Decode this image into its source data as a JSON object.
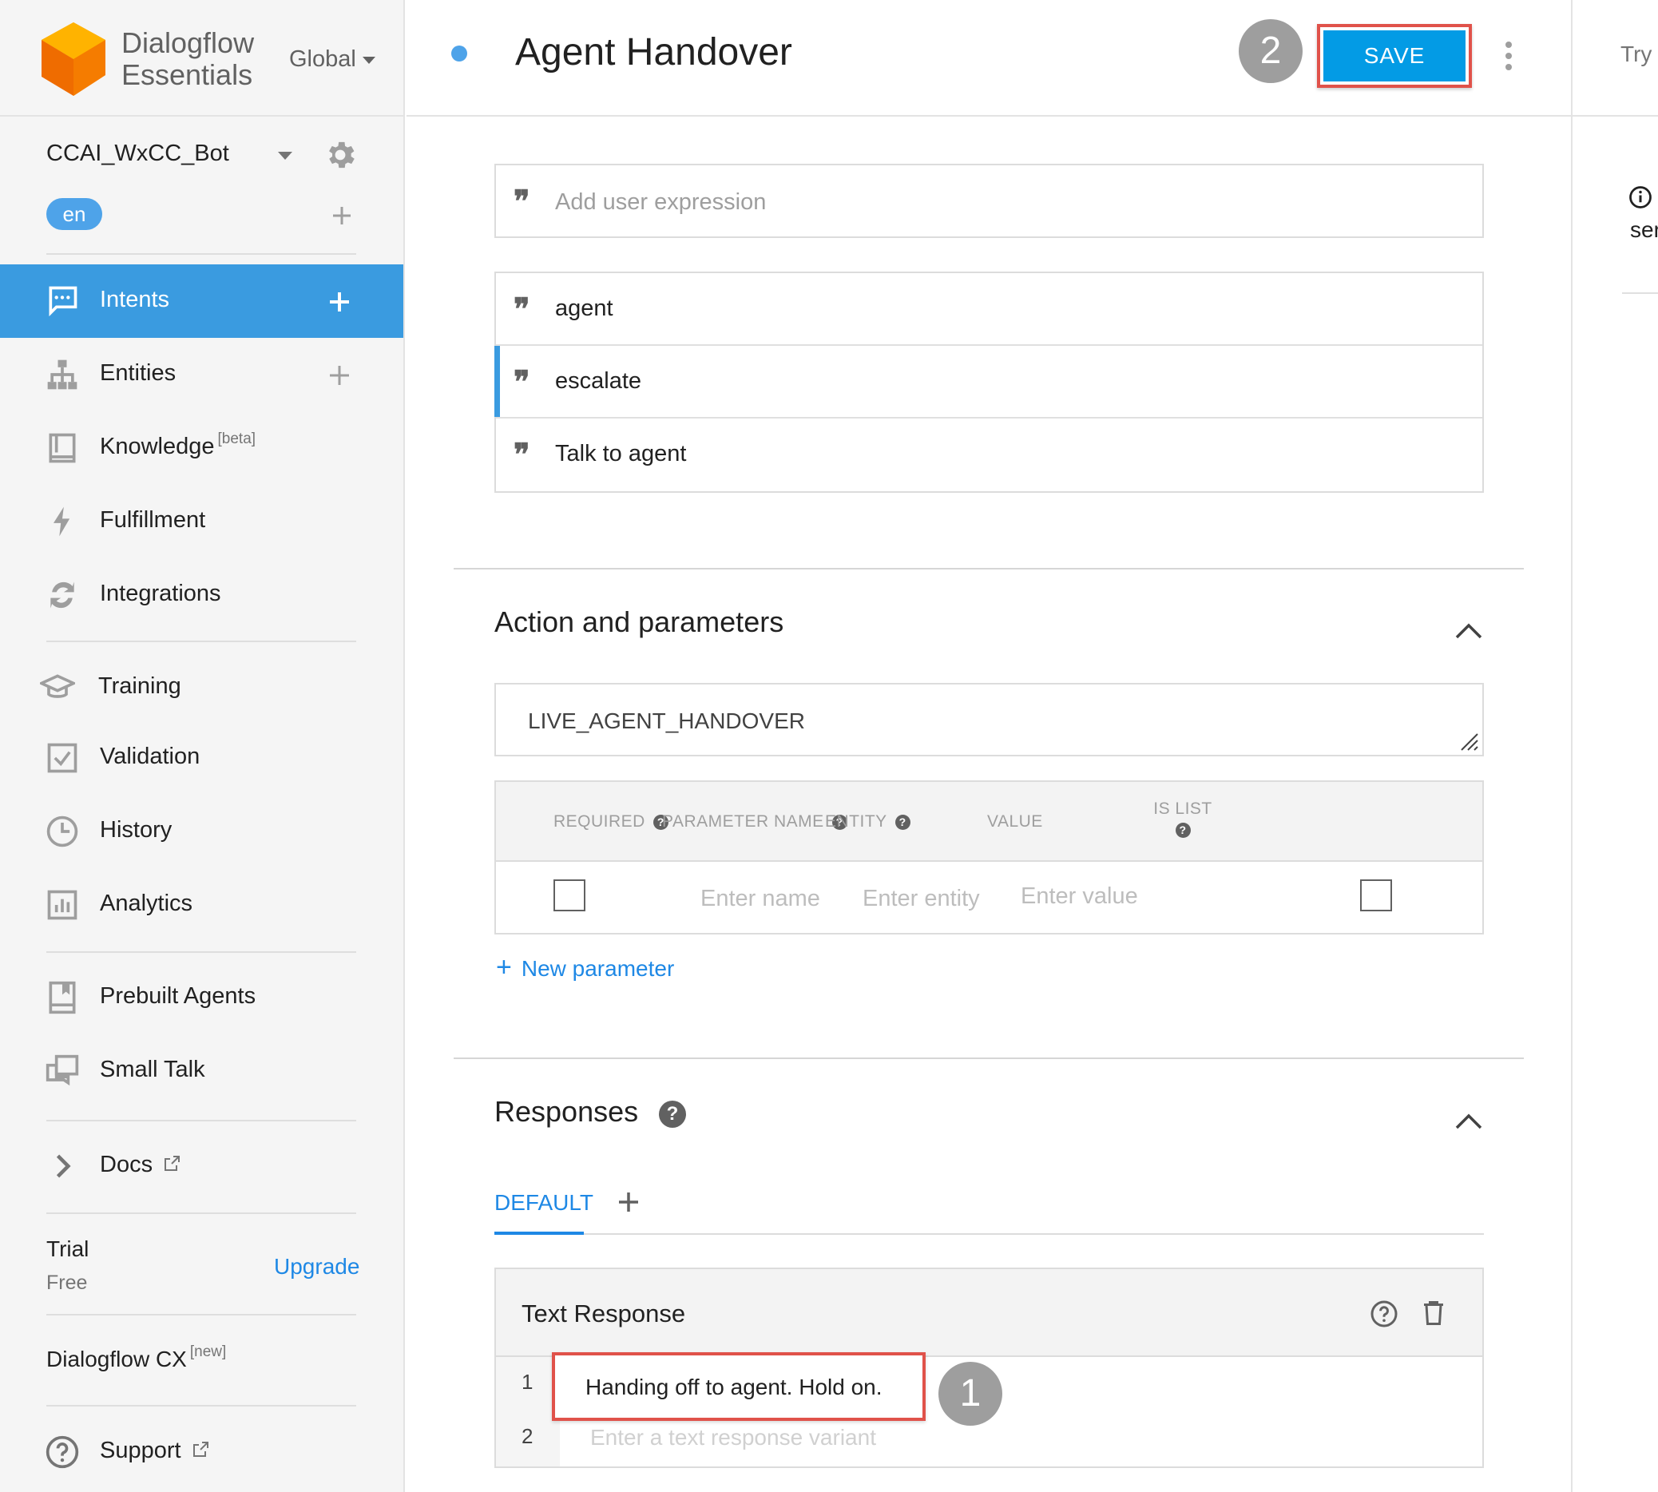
{
  "app": {
    "brand_line1": "Dialogflow",
    "brand_line2": "Essentials",
    "region": "Global"
  },
  "agent": {
    "name": "CCAI_WxCC_Bot",
    "language": "en"
  },
  "sidebar": {
    "items": [
      {
        "label": "Intents",
        "icon": "intents-icon",
        "active": true
      },
      {
        "label": "Entities",
        "icon": "entities-icon"
      },
      {
        "label": "Knowledge",
        "sup": "[beta]",
        "icon": "knowledge-icon"
      },
      {
        "label": "Fulfillment",
        "icon": "fulfillment-icon"
      },
      {
        "label": "Integrations",
        "icon": "integrations-icon"
      },
      {
        "label": "Training",
        "icon": "training-icon"
      },
      {
        "label": "Validation",
        "icon": "validation-icon"
      },
      {
        "label": "History",
        "icon": "history-icon"
      },
      {
        "label": "Analytics",
        "icon": "analytics-icon"
      },
      {
        "label": "Prebuilt Agents",
        "icon": "prebuilt-agents-icon"
      },
      {
        "label": "Small Talk",
        "icon": "small-talk-icon"
      },
      {
        "label": "Docs",
        "icon": "chevron-right-icon"
      }
    ],
    "trial": "Trial",
    "trial_plan": "Free",
    "upgrade": "Upgrade",
    "cx_label": "Dialogflow CX",
    "cx_sup": "[new]",
    "support": "Support"
  },
  "header": {
    "title": "Agent Handover",
    "save_label": "SAVE",
    "step_save": "2"
  },
  "training_phrases": {
    "placeholder": "Add user expression",
    "items": [
      "agent",
      "escalate",
      "Talk to agent"
    ]
  },
  "action": {
    "section_title": "Action and parameters",
    "action_name": "LIVE_AGENT_HANDOVER",
    "columns": [
      "REQUIRED",
      "PARAMETER NAME",
      "ENTITY",
      "VALUE",
      "IS LIST"
    ],
    "row": {
      "name_placeholder": "Enter name",
      "entity_placeholder": "Enter entity",
      "value_placeholder": "Enter value"
    },
    "new_parameter": "New parameter"
  },
  "responses": {
    "section_title": "Responses",
    "tab_default": "DEFAULT",
    "card_title": "Text Response",
    "lines": [
      {
        "num": "1",
        "text": "Handing off to agent. Hold on."
      },
      {
        "num": "2",
        "placeholder": "Enter a text response variant"
      }
    ],
    "step_response": "1"
  },
  "right_panel": {
    "try_label": "Try",
    "snippet": "ser"
  },
  "colors": {
    "accent": "#3a9be0",
    "save": "#039be5",
    "highlight": "#e0524a",
    "link": "#1e88e5"
  }
}
